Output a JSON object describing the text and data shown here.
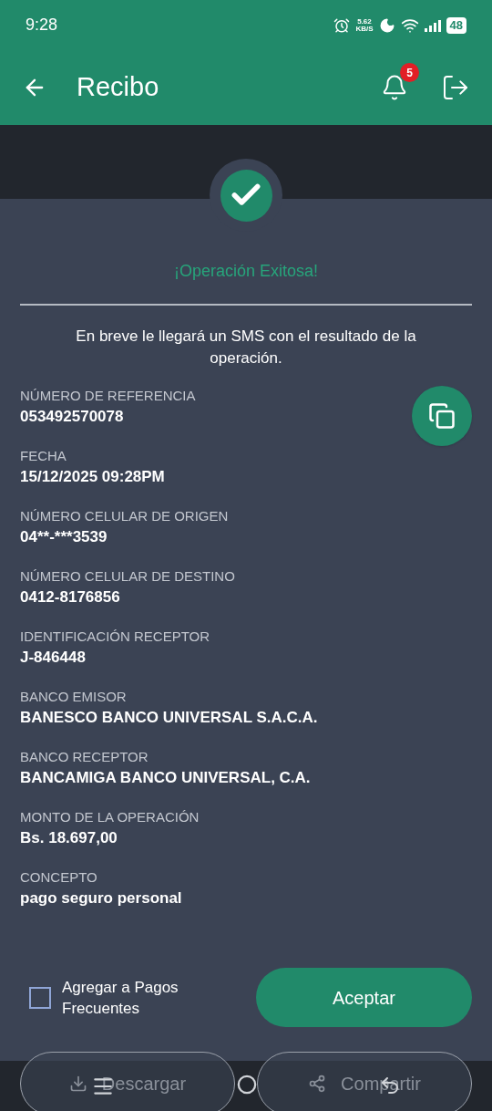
{
  "status_bar": {
    "time": "9:28",
    "net_speed": [
      "5.62",
      "KB/S"
    ],
    "battery": "48"
  },
  "header": {
    "title": "Recibo",
    "notification_count": "5"
  },
  "result": {
    "title": "¡Operación Exitosa!",
    "message": "En breve le llegará un SMS con el resultado de la operación."
  },
  "fields": [
    {
      "label": "NÚMERO DE REFERENCIA",
      "value": "053492570078"
    },
    {
      "label": "FECHA",
      "value": "15/12/2025 09:28PM"
    },
    {
      "label": "NÚMERO CELULAR DE ORIGEN",
      "value": "04**-***3539"
    },
    {
      "label": "NÚMERO CELULAR DE DESTINO",
      "value": "0412-8176856"
    },
    {
      "label": "IDENTIFICACIÓN RECEPTOR",
      "value": "J-846448"
    },
    {
      "label": "BANCO EMISOR",
      "value": "BANESCO BANCO UNIVERSAL S.A.C.A."
    },
    {
      "label": "BANCO RECEPTOR",
      "value": "BANCAMIGA BANCO UNIVERSAL, C.A."
    },
    {
      "label": "MONTO DE LA OPERACIÓN",
      "value": "Bs. 18.697,00"
    },
    {
      "label": "CONCEPTO",
      "value": "pago seguro personal"
    }
  ],
  "frequent_checkbox": {
    "label": "Agregar a Pagos Frecuentes",
    "checked": false
  },
  "accept_button": "Aceptar",
  "actions": [
    {
      "kind": "download",
      "label": "Descargar"
    },
    {
      "kind": "share",
      "label": "Compartir"
    }
  ]
}
